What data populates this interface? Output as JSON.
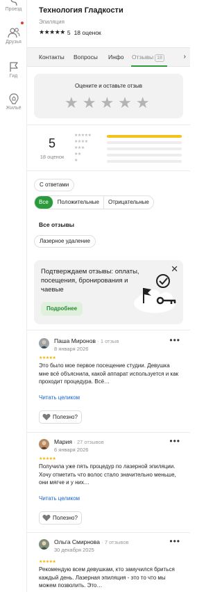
{
  "nav": {
    "items": [
      {
        "label": "Проезд",
        "icon": "route-icon"
      },
      {
        "label": "Друзья",
        "icon": "friends-icon"
      },
      {
        "label": "Гид",
        "icon": "flag-icon"
      },
      {
        "label": "Жильё",
        "icon": "housing-icon"
      }
    ]
  },
  "place": {
    "title": "Технология Гладкости",
    "category": "Эпиляция",
    "stars": "★★★★★",
    "rating": "5",
    "reviews_count": "18 оценок"
  },
  "tabs": [
    {
      "label": "Контакты"
    },
    {
      "label": "Вопросы"
    },
    {
      "label": "Инфо"
    },
    {
      "label": "Отзывы",
      "badge": "18",
      "active": true
    }
  ],
  "rate_card": {
    "title": "Оцените и оставьте отзыв",
    "stars": "★★★★★"
  },
  "summary": {
    "score": "5",
    "count": "18 оценок",
    "distribution": [
      {
        "stars": "★★★★★",
        "share": 1.0
      },
      {
        "stars": "★★★★",
        "share": 0.0
      },
      {
        "stars": "★★★",
        "share": 0.0
      },
      {
        "stars": "★★",
        "share": 0.0
      },
      {
        "stars": "★",
        "share": 0.0
      }
    ]
  },
  "filters": {
    "with_answers": "С ответами",
    "segments": [
      "Все",
      "Положительные",
      "Отрицательные"
    ],
    "active_segment": "Все",
    "section_title": "Все отзывы",
    "topic_chip": "Лазерное удаление"
  },
  "promo": {
    "text": "Подтверждаем отзывы: оплаты, посещения, бронирования и чаевые",
    "button": "Подробнее"
  },
  "reviews": [
    {
      "author": "Паша Миронов",
      "meta": "· 1 отзыв",
      "date": "8 января 2026",
      "stars": "★★★★★",
      "text": "Это было мое первое посещение студии. Девушка мне всё объяснила, какой аппарат используется и как проходит процедура. Всё…",
      "read_more": "Читать целиком",
      "helpful": "Полезно?"
    },
    {
      "author": "Мария",
      "meta": "· 27 отзывов",
      "date": "6 января 2026",
      "stars": "★★★★★",
      "text": "Получила уже пять процедур по лазерной эпиляции. Хочу отметить что волос стало значительно меньше, они мягче и у них…",
      "read_more": "Читать целиком",
      "helpful": "Полезно?"
    },
    {
      "author": "Ольга Смирнова",
      "meta": "· 7 отзывов",
      "date": "30 декабря 2025",
      "stars": "★★★★★",
      "text": "Рекомендую всем девушкам, кто замучился бриться каждый день. Лазерная эпиляция - это то что мы можем позволить. Это…",
      "read_more": "",
      "helpful": ""
    }
  ]
}
